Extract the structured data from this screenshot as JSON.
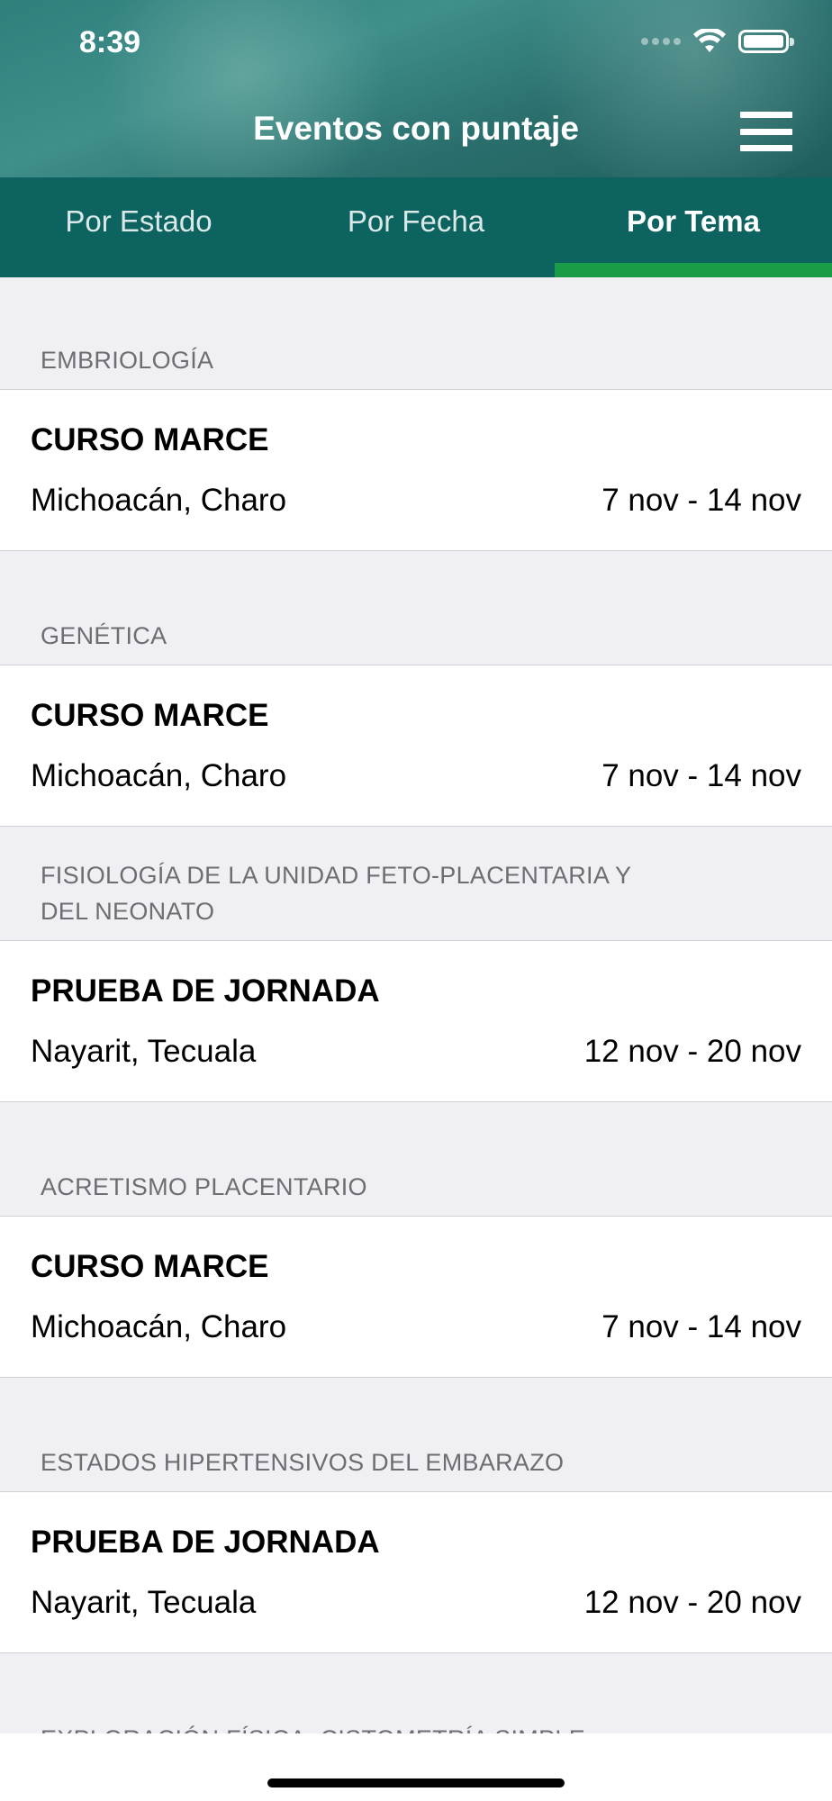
{
  "status_bar": {
    "time": "8:39"
  },
  "nav": {
    "title": "Eventos con puntaje",
    "menu_icon": "hamburger-menu-icon"
  },
  "tabs": [
    {
      "label": "Por Estado",
      "active": false
    },
    {
      "label": "Por Fecha",
      "active": false
    },
    {
      "label": "Por Tema",
      "active": true
    }
  ],
  "sections": [
    {
      "header": "EMBRIOLOGÍA",
      "event": {
        "title": "CURSO MARCE",
        "place": "Michoacán, Charo",
        "dates": "7 nov - 14 nov"
      }
    },
    {
      "header": "GENÉTICA",
      "event": {
        "title": "CURSO MARCE",
        "place": "Michoacán, Charo",
        "dates": "7 nov - 14 nov"
      }
    },
    {
      "header": "FISIOLOGÍA DE LA UNIDAD FETO-PLACENTARIA Y DEL NEONATO",
      "event": {
        "title": "PRUEBA DE JORNADA",
        "place": "Nayarit, Tecuala",
        "dates": "12 nov - 20 nov"
      }
    },
    {
      "header": "ACRETISMO PLACENTARIO",
      "event": {
        "title": "CURSO MARCE",
        "place": "Michoacán, Charo",
        "dates": "7 nov - 14 nov"
      }
    },
    {
      "header": "ESTADOS HIPERTENSIVOS DEL EMBARAZO",
      "event": {
        "title": "PRUEBA DE JORNADA",
        "place": "Nayarit, Tecuala",
        "dates": "12 nov - 20 nov"
      }
    },
    {
      "header": "EXPLORACIÓN FÍSICA, CISTOMETRÍA SIMPLE"
    }
  ],
  "colors": {
    "header_teal": "#2f7f7c",
    "tab_bar": "#0c6360",
    "active_tab_indicator": "#1a9b47",
    "list_background": "#efeff4",
    "section_header_text": "#6d6d72"
  }
}
